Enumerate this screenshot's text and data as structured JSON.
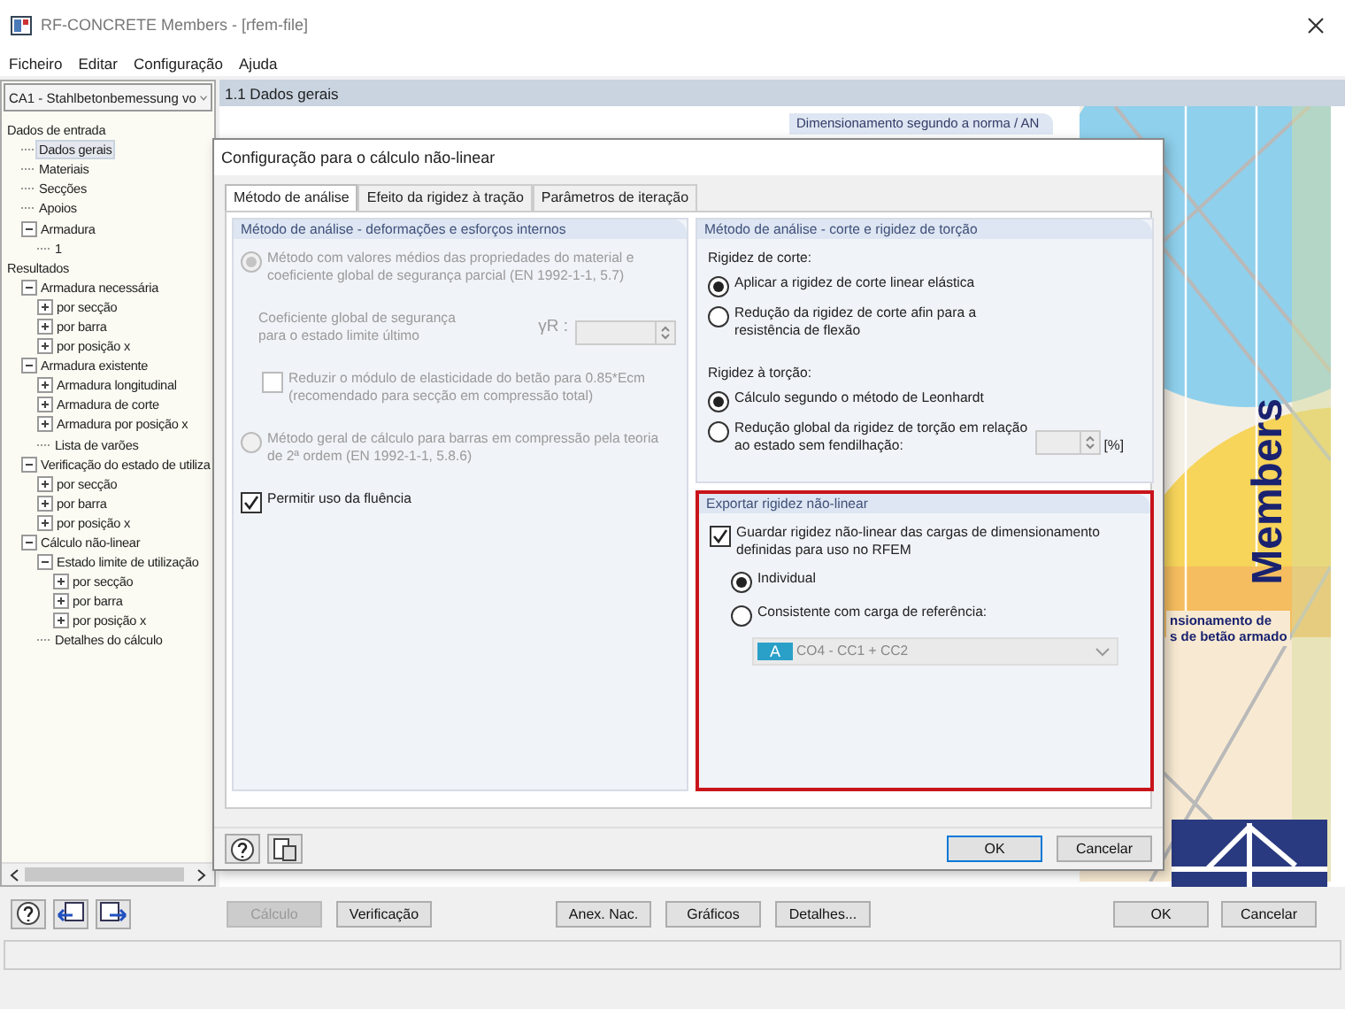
{
  "window": {
    "title": "RF-CONCRETE Members - [rfem-file]"
  },
  "menu": [
    "Ficheiro",
    "Editar",
    "Configuração",
    "Ajuda"
  ],
  "case_selector": {
    "value": "CA1 - Stahlbetonbemessung vo"
  },
  "tree": [
    {
      "label": "Dados de entrada",
      "selected": false,
      "children": [
        {
          "label": "Dados gerais",
          "selected": true
        },
        {
          "label": "Materiais",
          "selected": false
        },
        {
          "label": "Secções",
          "selected": false
        },
        {
          "label": "Apoios",
          "selected": false
        },
        {
          "label": "Armadura",
          "selected": false,
          "expanded": true,
          "children": [
            {
              "label": "1",
              "selected": false
            }
          ]
        }
      ]
    },
    {
      "label": "Resultados",
      "selected": false,
      "children": [
        {
          "label": "Armadura necessária",
          "selected": false,
          "expanded": true,
          "children": [
            {
              "label": "por secção",
              "selected": false,
              "expanded": false
            },
            {
              "label": "por barra",
              "selected": false,
              "expanded": false
            },
            {
              "label": "por posição x",
              "selected": false,
              "expanded": false
            }
          ]
        },
        {
          "label": "Armadura existente",
          "selected": false,
          "expanded": true,
          "children": [
            {
              "label": "Armadura longitudinal",
              "selected": false,
              "expanded": false
            },
            {
              "label": "Armadura de corte",
              "selected": false,
              "expanded": false
            },
            {
              "label": "Armadura por posição x",
              "selected": false,
              "expanded": false
            },
            {
              "label": "Lista de varões",
              "selected": false
            }
          ]
        },
        {
          "label": "Verificação do estado de utiliza",
          "selected": false,
          "expanded": true,
          "children": [
            {
              "label": "por secção",
              "selected": false,
              "expanded": false
            },
            {
              "label": "por barra",
              "selected": false,
              "expanded": false
            },
            {
              "label": "por posição x",
              "selected": false,
              "expanded": false
            }
          ]
        },
        {
          "label": "Cálculo não-linear",
          "selected": false,
          "expanded": true,
          "children": [
            {
              "label": "Estado limite de utilização",
              "selected": false,
              "expanded": true,
              "children": [
                {
                  "label": "por secção",
                  "selected": false,
                  "expanded": false
                },
                {
                  "label": "por barra",
                  "selected": false,
                  "expanded": false
                },
                {
                  "label": "por posição x",
                  "selected": false,
                  "expanded": false
                }
              ]
            },
            {
              "label": "Detalhes do cálculo",
              "selected": false
            }
          ]
        }
      ]
    }
  ],
  "section_header": "1.1 Dados gerais",
  "norm_tab": "Dimensionamento segundo a norma / AN",
  "banner": {
    "title": "Members",
    "subtitle_lines": [
      "nsionamento de",
      "s de betão armado"
    ]
  },
  "toolbar_buttons": [
    {
      "label": "Cálculo",
      "disabled": true
    },
    {
      "label": "Verificação",
      "disabled": false
    },
    {
      "label": "Anex. Nac.",
      "disabled": false
    },
    {
      "label": "Gráficos",
      "disabled": false
    },
    {
      "label": "Detalhes...",
      "disabled": false
    }
  ],
  "main_ok": "OK",
  "main_cancel": "Cancelar",
  "dialog": {
    "title": "Configuração para o cálculo não-linear",
    "tabs": [
      {
        "label": "Método de análise",
        "selected": true
      },
      {
        "label": "Efeito da rigidez à tração",
        "selected": false
      },
      {
        "label": "Parâmetros de iteração",
        "selected": false
      }
    ],
    "analysis_group": {
      "title": "Método de análise - deformações e esforços internos",
      "items": [
        {
          "kind": "radio",
          "label": "Método com valores médios das propriedades do material e coeficiente global de segurança parcial (EN 1992-1-1, 5.7)",
          "selected": true,
          "disabled": true
        },
        {
          "kind": "spin",
          "label": "Coeficiente global de segurança para o estado limite último",
          "symbol": "γR :",
          "disabled": true
        },
        {
          "kind": "checkbox",
          "label": "Reduzir o módulo de elasticidade do betão para 0.85*Ecm (recomendado para secção em compressão total)",
          "checked": false,
          "disabled": true
        },
        {
          "kind": "radio",
          "label": "Método geral de cálculo para barras em compressão pela teoria de 2ª ordem (EN 1992-1-1, 5.8.6)",
          "selected": false,
          "disabled": true
        },
        {
          "kind": "checkbox",
          "label": "Permitir uso da fluência",
          "checked": true,
          "disabled": false
        }
      ]
    },
    "shear_group": {
      "title": "Método de análise - corte e rigidez de torção",
      "items": [
        {
          "kind": "heading",
          "label": "Rigidez de corte:"
        },
        {
          "kind": "radio",
          "label": "Aplicar a rigidez de corte linear elástica",
          "selected": true,
          "disabled": false
        },
        {
          "kind": "radio",
          "label": "Redução da rigidez de corte afin para a resistência de flexão",
          "selected": false,
          "disabled": false
        },
        {
          "kind": "heading",
          "label": "Rigidez à torção:"
        },
        {
          "kind": "radio",
          "label": "Cálculo segundo o método de Leonhardt",
          "selected": true,
          "disabled": false
        },
        {
          "kind": "radio_spin",
          "label": "Redução global da rigidez de torção em relação ao estado sem fendilhação:",
          "unit": "[%]",
          "selected": false,
          "disabled": false
        }
      ]
    },
    "export_group": {
      "title": "Exportar rigidez não-linear",
      "highlighted": true,
      "items": [
        {
          "kind": "checkbox",
          "label": "Guardar rigidez não-linear das cargas de dimensionamento definidas para uso no RFEM",
          "checked": true,
          "disabled": false
        },
        {
          "kind": "option",
          "label": "Individual",
          "selected": true,
          "disabled": false
        },
        {
          "kind": "option",
          "label": "Consistente com carga de referência:",
          "selected": false,
          "disabled": false
        },
        {
          "kind": "dropdown",
          "badge": "A",
          "color": "#2aa0c8",
          "value": "CO4 - CC1 + CC2",
          "disabled": true
        }
      ]
    },
    "ok": "OK",
    "cancel": "Cancelar"
  }
}
